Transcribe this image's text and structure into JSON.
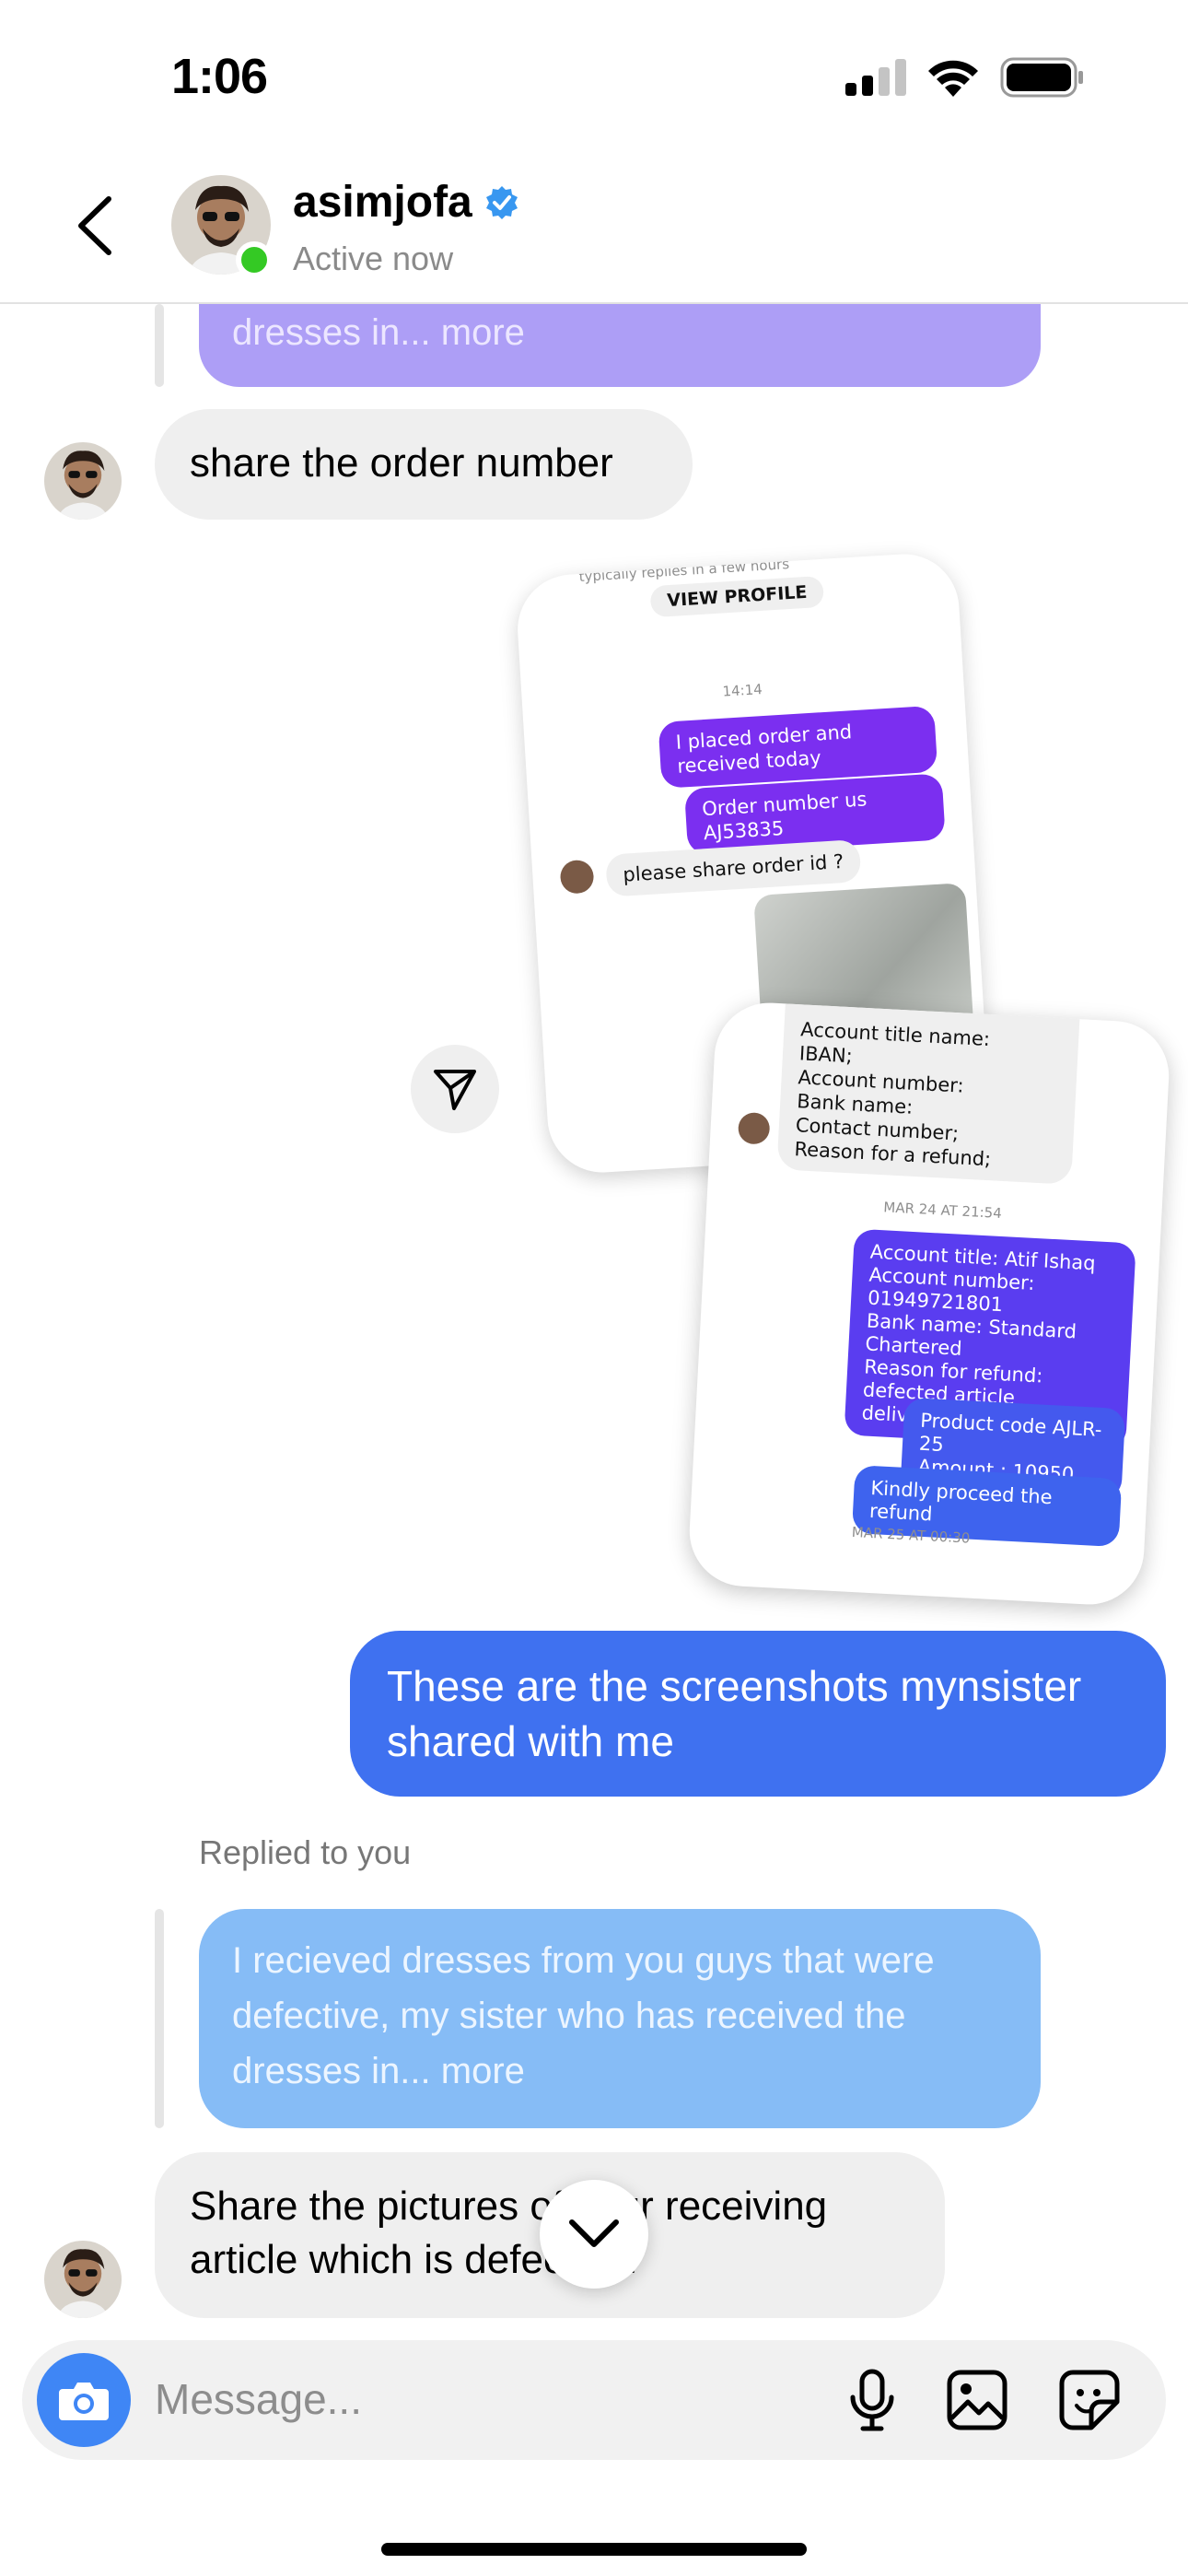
{
  "status_bar": {
    "time": "1:06"
  },
  "header": {
    "username": "asimjofa",
    "activity": "Active now"
  },
  "messages": {
    "reply_preview_top": "dresses in... more",
    "order_request": "share the order number",
    "screenshot_1": {
      "header_fragment": "typically replies in a few hours",
      "view_profile": "VIEW PROFILE",
      "timestamp": "14:14",
      "bubble_1": "I placed order and received today",
      "bubble_2": "Order number us AJ53835",
      "bubble_3": "please share order id ?"
    },
    "screenshot_2": {
      "gray_text": "Account title name:\nIBAN;\nAccount number:\nBank name:\nContact number;\nReason for a refund;",
      "timestamp_1": "MAR 24 AT 21:54",
      "bubble_1": "Account title: Atif Ishaq\nAccount number:\n01949721801\nBank name: Standard Chartered\nReason for refund: defected article delivered.",
      "bubble_2": "Product code AJLR-25\nAmount : 10950",
      "bubble_3": "Kindly proceed the refund",
      "timestamp_2": "MAR 25 AT 00:30"
    },
    "outgoing": "These are the screenshots mynsister shared with me",
    "replied_label": "Replied to you",
    "reply_preview": "I recieved dresses from you guys that were defective, my sister who has received the dresses in... more",
    "last_incoming": "Share the pictures of your receiving article which is defective."
  },
  "composer": {
    "placeholder": "Message..."
  },
  "colors": {
    "outgoing_bubble": "#3f71f0",
    "incoming_bubble": "#efefef",
    "reply_blue": "#86bcf6",
    "reply_purple": "#ad9ef6",
    "online": "#34c924",
    "verified": "#3897f0"
  },
  "icons": [
    "back-icon",
    "verified-icon",
    "send-icon",
    "chevron-down-icon",
    "camera-icon",
    "microphone-icon",
    "image-icon",
    "sticker-icon",
    "signal-icon",
    "wifi-icon",
    "battery-icon"
  ]
}
